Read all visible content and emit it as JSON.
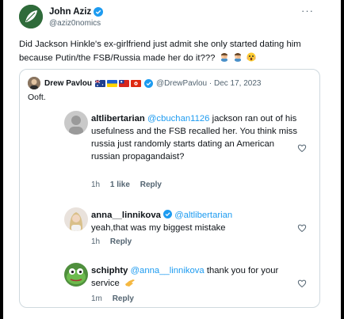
{
  "tweet": {
    "author_name": "John Aziz",
    "author_handle": "@aziz0nomics",
    "text": "Did Jackson Hinkle's ex-girlfriend just admit she only started dating him because Putin/the FSB/Russia made her do it???",
    "emojis": [
      "man-facepalming",
      "man-facepalming",
      "face-screaming"
    ],
    "more_icon": "···"
  },
  "quoted": {
    "author_name": "Drew Pavlou",
    "flags": [
      "australia-flag",
      "ukraine-flag",
      "taiwan-flag",
      "hong-kong-flag"
    ],
    "handle_date": "@DrewPavlou · Dec 17, 2023",
    "text": "Ooft.",
    "replies": [
      {
        "user": "altlibertarian",
        "mention": "@cbuchan1126",
        "text": " jackson ran out of his usefulness and the FSB recalled her. You think miss russia just randomly starts dating an American russian propagandaist?",
        "time": "1h",
        "likes": "1 like",
        "reply_label": "Reply"
      },
      {
        "user": "anna__linnikova",
        "mention": "@altlibertarian",
        "text": "yeah,that was my biggest mistake",
        "time": "1h",
        "reply_label": "Reply"
      },
      {
        "user": "schiphty",
        "mention": "@anna__linnikova",
        "text": " thank you for your service",
        "time": "1m",
        "reply_label": "Reply"
      }
    ]
  },
  "colors": {
    "accent": "#1d9bf0",
    "muted": "#536471",
    "border": "#cfd9de"
  }
}
